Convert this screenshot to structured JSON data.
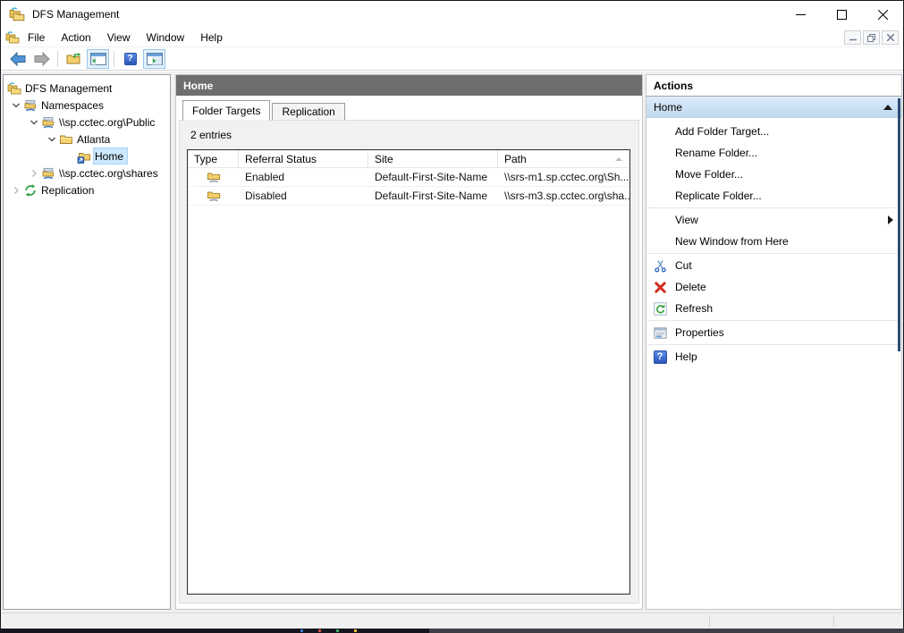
{
  "window": {
    "title": "DFS Management"
  },
  "menu": {
    "items": [
      "File",
      "Action",
      "View",
      "Window",
      "Help"
    ]
  },
  "toolbar": {
    "buttons": [
      "back",
      "forward",
      "export-list",
      "show-hide-console-tree",
      "help",
      "show-hide-action-pane"
    ]
  },
  "icons": {
    "help_glyph": "?"
  },
  "tree": {
    "items": [
      {
        "label": "DFS Management"
      },
      {
        "label": "Namespaces",
        "state": "expanded"
      },
      {
        "label": "\\\\sp.cctec.org\\Public",
        "state": "expanded"
      },
      {
        "label": "Atlanta",
        "state": "expanded"
      },
      {
        "label": "Home",
        "selected": true
      },
      {
        "label": "\\\\sp.cctec.org\\shares",
        "state": "collapsed"
      },
      {
        "label": "Replication",
        "state": "collapsed"
      }
    ]
  },
  "content": {
    "header": "Home",
    "tabs": [
      {
        "label": "Folder Targets",
        "active": true
      },
      {
        "label": "Replication",
        "active": false
      }
    ],
    "entries_label": "2 entries",
    "table": {
      "columns": [
        "Type",
        "Referral Status",
        "Site",
        "Path"
      ],
      "sorted_by": "Path",
      "rows": [
        {
          "referral_status": "Enabled",
          "site": "Default-First-Site-Name",
          "path": "\\\\srs-m1.sp.cctec.org\\Sh..."
        },
        {
          "referral_status": "Disabled",
          "site": "Default-First-Site-Name",
          "path": "\\\\srs-m3.sp.cctec.org\\sha..."
        }
      ]
    }
  },
  "actions": {
    "title": "Actions",
    "section": {
      "label": "Home",
      "collapsed": false
    },
    "items": [
      {
        "label": "Add Folder Target..."
      },
      {
        "label": "Rename Folder..."
      },
      {
        "label": "Move Folder..."
      },
      {
        "label": "Replicate Folder..."
      },
      {
        "label": "View",
        "submenu": true
      },
      {
        "label": "New Window from Here"
      },
      {
        "label": "Cut",
        "icon": "cut"
      },
      {
        "label": "Delete",
        "icon": "delete"
      },
      {
        "label": "Refresh",
        "icon": "refresh"
      },
      {
        "label": "Properties",
        "icon": "properties"
      },
      {
        "label": "Help",
        "icon": "help"
      }
    ]
  },
  "colors": {
    "selection": "#cce8ff",
    "pane_header": "#6e6e6e",
    "section_header_top": "#dcecf9",
    "section_header_bottom": "#bdd8ee",
    "toggle_button": "#e4f1fb"
  }
}
